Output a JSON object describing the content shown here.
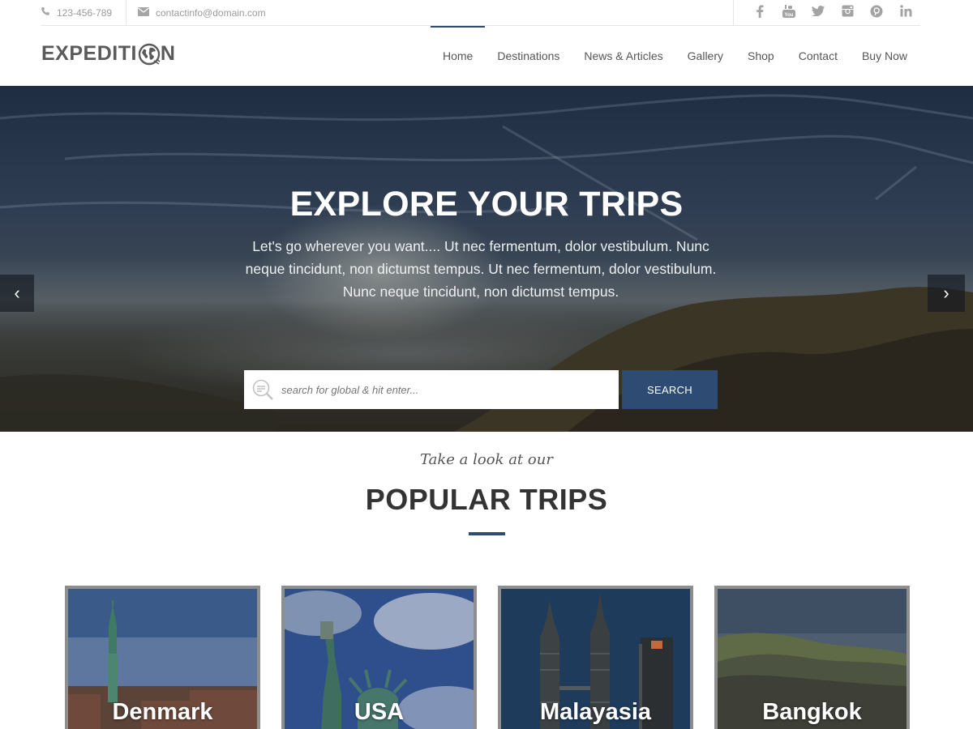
{
  "topbar": {
    "phone": "123-456-789",
    "email": "contactinfo@domain.com",
    "social": [
      {
        "icon": "facebook-icon",
        "glyph": "f"
      },
      {
        "icon": "youtube-icon",
        "glyph": "▶"
      },
      {
        "icon": "twitter-icon",
        "glyph": "🐦"
      },
      {
        "icon": "instagram-icon",
        "glyph": "◎"
      },
      {
        "icon": "pinterest-icon",
        "glyph": "ⓟ"
      },
      {
        "icon": "linkedin-icon",
        "glyph": "in"
      }
    ]
  },
  "header": {
    "logo_prefix": "EXPEDITI",
    "logo_suffix": "N",
    "nav": [
      {
        "label": "Home",
        "active": true
      },
      {
        "label": "Destinations",
        "active": false
      },
      {
        "label": "News & Articles",
        "active": false
      },
      {
        "label": "Gallery",
        "active": false
      },
      {
        "label": "Shop",
        "active": false
      },
      {
        "label": "Contact",
        "active": false
      },
      {
        "label": "Buy Now",
        "active": false
      }
    ]
  },
  "hero": {
    "title": "EXPLORE YOUR TRIPS",
    "subtitle": "Let's go wherever you want.... Ut nec fermentum, dolor vestibulum. Nunc neque tincidunt, non dictumst tempus. Ut nec fermentum, dolor vestibulum. Nunc neque tincidunt, non dictumst tempus.",
    "search_placeholder": "search for global & hit enter...",
    "search_button": "SEARCH",
    "prev_arrow": "‹",
    "next_arrow": "›"
  },
  "popular": {
    "pre_title": "Take a look at our",
    "title": "POPULAR TRIPS",
    "trips": [
      "Denmark",
      "USA",
      "Malayasia",
      "Bangkok"
    ]
  },
  "colors": {
    "accent": "#2d4b73",
    "card_border": "#8e8e8e"
  }
}
